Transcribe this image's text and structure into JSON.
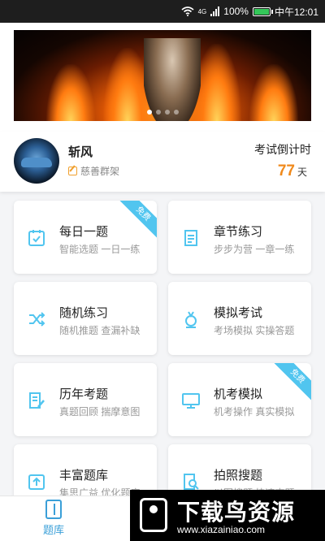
{
  "status_bar": {
    "battery_percent": "100%",
    "network_label": "4G",
    "time": "中午12:01"
  },
  "banner": {
    "indicator_count": 4,
    "active_index": 0
  },
  "profile": {
    "name": "斩风",
    "subtitle": "慈善群架",
    "countdown_label": "考试倒计时",
    "countdown_value": "77",
    "countdown_unit": "天"
  },
  "cards": [
    {
      "title": "每日一题",
      "subtitle": "智能选题 一日一练",
      "icon": "calendar-check-icon",
      "badge": "免费"
    },
    {
      "title": "章节练习",
      "subtitle": "步步为营 一章一练",
      "icon": "document-list-icon",
      "badge": ""
    },
    {
      "title": "随机练习",
      "subtitle": "随机推题 查漏补缺",
      "icon": "shuffle-icon",
      "badge": ""
    },
    {
      "title": "模拟考试",
      "subtitle": "考场模拟 实操答题",
      "icon": "certificate-icon",
      "badge": ""
    },
    {
      "title": "历年考题",
      "subtitle": "真题回顾 揣摩意图",
      "icon": "edit-document-icon",
      "badge": ""
    },
    {
      "title": "机考模拟",
      "subtitle": "机考操作 真实模拟",
      "icon": "monitor-icon",
      "badge": "免费"
    },
    {
      "title": "丰富题库",
      "subtitle": "集思广益 优化题库",
      "icon": "upload-box-icon",
      "badge": ""
    },
    {
      "title": "拍照搜题",
      "subtitle": "以图搜题 快速查题",
      "icon": "search-document-icon",
      "badge": ""
    }
  ],
  "tab_bar": {
    "active_tab_label": "题库"
  },
  "watermark": {
    "title": "下载鸟资源",
    "url": "www.xiazainiao.com"
  },
  "colors": {
    "accent": "#51c5ef",
    "countdown": "#f08a1c",
    "tab_active": "#3a9fd8"
  }
}
